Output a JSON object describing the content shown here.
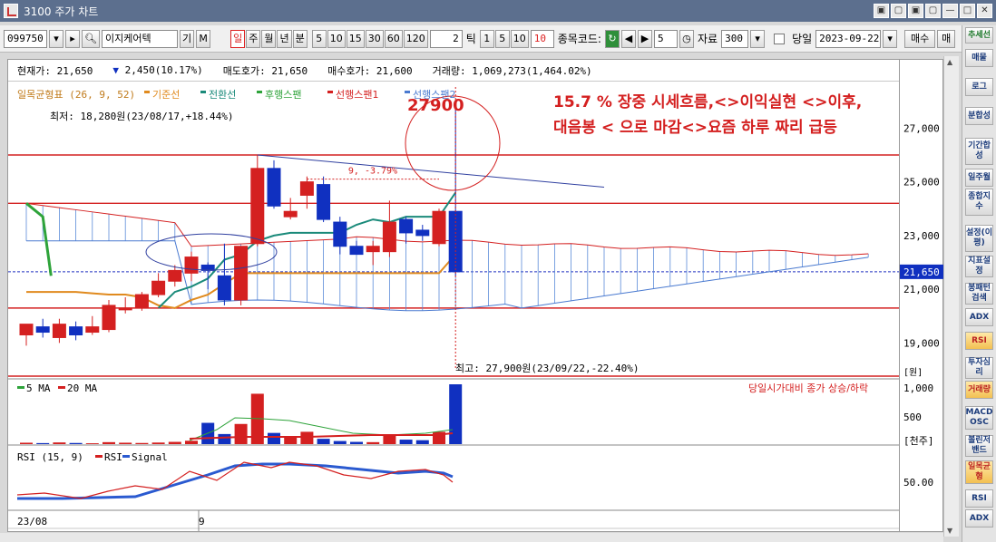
{
  "window": {
    "title": "3100 주가 차트",
    "buttons": [
      "▣",
      "▢",
      "▣",
      "▢",
      "—",
      "□",
      "✕"
    ]
  },
  "toolbar": {
    "code": "099750",
    "name": "이지케어텍",
    "gi": "기",
    "m": "M",
    "periods": [
      "일",
      "주",
      "월",
      "년",
      "분"
    ],
    "minutes": [
      "5",
      "10",
      "15",
      "30",
      "60",
      "120"
    ],
    "tick_value": "2",
    "tick_label": "틱",
    "ticks": [
      "1",
      "5",
      "10"
    ],
    "tick_red": "10",
    "code_label": "종목코드:",
    "count_value": "5",
    "data_label": "자료",
    "data_value": "300",
    "today_label": "당일",
    "date": "2023-09-22",
    "buy": "매수",
    "sell": "매"
  },
  "infobar": {
    "price": "현재가: 21,650",
    "change": "2,450(10.17%)",
    "ask": "매도호가: 21,650",
    "bid": "매수호가: 21,600",
    "volume": "거래량: 1,069,273(1,464.02%)"
  },
  "price_panel": {
    "indicator": "일목균형표 (26, 9, 52)",
    "legend": [
      {
        "name": "기준선",
        "color": "#e08a1e"
      },
      {
        "name": "전환선",
        "color": "#1a8a7a"
      },
      {
        "name": "후행스팬",
        "color": "#2ea33a"
      },
      {
        "name": "선행스팬1",
        "color": "#d42020"
      },
      {
        "name": "선행스팬2",
        "color": "#4a7ad0"
      }
    ],
    "low_label": "최저: 18,280원(23/08/17,+18.44%)",
    "high_label": "최고: 27,900원(23/09/22,-22.40%)",
    "annot_price": "27900",
    "annot_line1": "15.7 % 장중 시세흐름,<>이익실현 <>이후,",
    "annot_line2": "대음봉 < 으로 마감<>요즘 하루 짜리 급등",
    "trend_label": "9, -3.79%",
    "yticks": [
      "27,000",
      "25,000",
      "23,000",
      "21,000",
      "19,000"
    ],
    "current_tag": "21,650",
    "unit": "[원]"
  },
  "volume_panel": {
    "legend": [
      "5 MA",
      "20 MA"
    ],
    "legend_colors": [
      "#2ea33a",
      "#d42020"
    ],
    "note": "당일시가대비 종가 상승/하락",
    "yticks": [
      "1,000",
      "500"
    ],
    "unit": "[천주]"
  },
  "rsi_panel": {
    "legend": "RSI (15, 9)",
    "series": [
      "RSI",
      "Signal"
    ],
    "series_colors": [
      "#d42020",
      "#2a5ad0"
    ],
    "ytick": "50.00",
    "level": "30"
  },
  "xaxis": [
    "23/08",
    "9"
  ],
  "sidebar": {
    "items": [
      "추세선",
      "매물",
      "로그",
      "분합성",
      "기간합성",
      "일주월",
      "종합지수",
      "설정(이평)",
      "지표설정",
      "봉패턴검색",
      "ADX",
      "RSI",
      "투자심리",
      "거래량",
      "MACD OSC",
      "볼린저밴드",
      "일목균형",
      "RSI",
      "ADX"
    ]
  },
  "chart_data": {
    "type": "candlestick",
    "price_range": [
      18000,
      28000
    ],
    "candles": [
      {
        "o": 19300,
        "h": 19700,
        "l": 18900,
        "c": 19700
      },
      {
        "o": 19600,
        "h": 19900,
        "l": 19200,
        "c": 19400
      },
      {
        "o": 19200,
        "h": 19900,
        "l": 19000,
        "c": 19700
      },
      {
        "o": 19600,
        "h": 19800,
        "l": 19100,
        "c": 19300
      },
      {
        "o": 19400,
        "h": 20000,
        "l": 19300,
        "c": 19600
      },
      {
        "o": 19500,
        "h": 20600,
        "l": 19400,
        "c": 20400
      },
      {
        "o": 20300,
        "h": 20700,
        "l": 20100,
        "c": 20300
      },
      {
        "o": 20300,
        "h": 20900,
        "l": 20200,
        "c": 20800
      },
      {
        "o": 20800,
        "h": 21600,
        "l": 20700,
        "c": 21300
      },
      {
        "o": 21300,
        "h": 21900,
        "l": 21100,
        "c": 21700
      },
      {
        "o": 21600,
        "h": 22400,
        "l": 21300,
        "c": 22200
      },
      {
        "o": 21900,
        "h": 22000,
        "l": 21000,
        "c": 21700
      },
      {
        "o": 21500,
        "h": 22700,
        "l": 20400,
        "c": 20600
      },
      {
        "o": 20600,
        "h": 22500,
        "l": 20400,
        "c": 22600
      },
      {
        "o": 22700,
        "h": 26000,
        "l": 22600,
        "c": 25500
      },
      {
        "o": 25500,
        "h": 25800,
        "l": 24000,
        "c": 24100
      },
      {
        "o": 23700,
        "h": 24400,
        "l": 23600,
        "c": 23900
      },
      {
        "o": 24500,
        "h": 25200,
        "l": 24000,
        "c": 25000
      },
      {
        "o": 24900,
        "h": 25200,
        "l": 23500,
        "c": 23600
      },
      {
        "o": 23500,
        "h": 23700,
        "l": 22300,
        "c": 22600
      },
      {
        "o": 22600,
        "h": 22800,
        "l": 22300,
        "c": 22300
      },
      {
        "o": 22400,
        "h": 22800,
        "l": 21900,
        "c": 22600
      },
      {
        "o": 22400,
        "h": 24300,
        "l": 22200,
        "c": 23500
      },
      {
        "o": 23600,
        "h": 23700,
        "l": 22700,
        "c": 23100
      },
      {
        "o": 23200,
        "h": 23400,
        "l": 22800,
        "c": 23000
      },
      {
        "o": 22700,
        "h": 24000,
        "l": 22600,
        "c": 23900
      },
      {
        "o": 23900,
        "h": 27900,
        "l": 21500,
        "c": 21650
      }
    ],
    "volumes": [
      25,
      18,
      30,
      20,
      15,
      35,
      25,
      20,
      28,
      40,
      60,
      380,
      180,
      360,
      900,
      200,
      120,
      220,
      95,
      55,
      40,
      35,
      150,
      80,
      70,
      220,
      1069
    ]
  }
}
